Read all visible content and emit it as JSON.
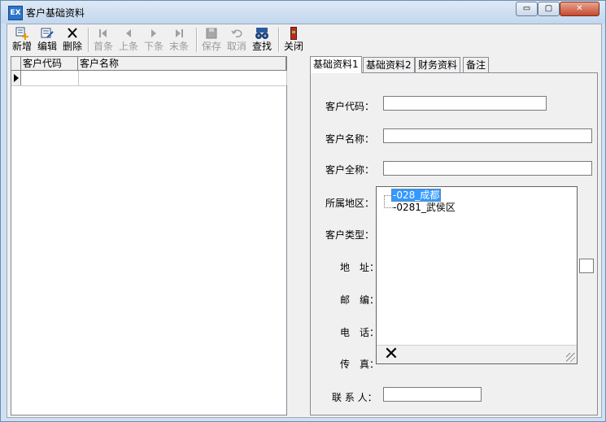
{
  "window": {
    "title": "客户基础资料",
    "app_icon_text": "EX",
    "caption_buttons": {
      "minimize": "▭",
      "maximize": "▢",
      "close": "✕"
    }
  },
  "toolbar": {
    "new": {
      "label": "新增",
      "icon": "add-icon"
    },
    "edit": {
      "label": "编辑",
      "icon": "edit-icon"
    },
    "delete": {
      "label": "删除",
      "icon": "delete-icon"
    },
    "first": {
      "label": "首条",
      "icon": "first-icon"
    },
    "prev": {
      "label": "上条",
      "icon": "prev-icon"
    },
    "next": {
      "label": "下条",
      "icon": "next-icon"
    },
    "last": {
      "label": "末条",
      "icon": "last-icon"
    },
    "save": {
      "label": "保存",
      "icon": "save-icon"
    },
    "cancel": {
      "label": "取消",
      "icon": "undo-icon"
    },
    "find": {
      "label": "查找",
      "icon": "binoculars-icon"
    },
    "close": {
      "label": "关闭",
      "icon": "exit-door-icon"
    }
  },
  "grid": {
    "columns": [
      "客户代码",
      "客户名称"
    ],
    "rows": [
      [
        "",
        ""
      ]
    ]
  },
  "tabs": [
    "基础资料1",
    "基础资料2",
    "财务资料",
    "备注"
  ],
  "form": {
    "code_label": "客户代码：",
    "name_label": "客户名称：",
    "fullname_label": "客户全称：",
    "region_label": "所属地区：",
    "type_label": "客户类型：",
    "address_label": "地　址：",
    "zip_label": "邮　编：",
    "phone_label": "电　话：",
    "fax_label": "传　真：",
    "contact_label": "联 系 人：",
    "code_value": "",
    "name_value": "",
    "fullname_value": "",
    "region_value": "",
    "contact_value": ""
  },
  "region_dropdown": {
    "nodes": [
      "-028_成都",
      "-0281_武侯区"
    ],
    "selected_index": 0
  },
  "colors": {
    "selection": "#3399ff",
    "title_bar": "#c3d7ee",
    "close_button": "#c44a2f"
  }
}
